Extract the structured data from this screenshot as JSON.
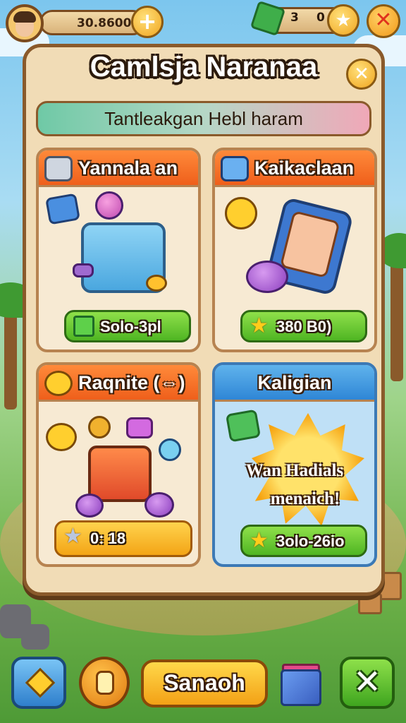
{
  "hud": {
    "coins": "30.8600",
    "gems_count": "3",
    "gems_extra": "0"
  },
  "panel": {
    "title": "Camlsja Naranaa",
    "subtitle": "Tantleakgan Hebl haram"
  },
  "cards": [
    {
      "title": "Yannala an",
      "price": "Solo-3pl",
      "price_icon": "cash-icon",
      "theme": "orange"
    },
    {
      "title": "Kaikaclaan",
      "price": "380 B0)",
      "price_icon": "star-icon",
      "theme": "orange"
    },
    {
      "title": "Raqnite (⇔)",
      "price": "0: 18",
      "price_icon": "star-icon",
      "theme": "orange"
    },
    {
      "title": "Kaligian",
      "burst_line1": "Wan Hadials",
      "burst_line2": "menaich!",
      "price": "3olo-26io",
      "price_icon": "star-icon",
      "theme": "blue"
    }
  ],
  "bottom_bar": {
    "center_button": "Sanaoh"
  },
  "colors": {
    "panel_bg": "#f1dcb6",
    "card_header_orange": "#ef5f1b",
    "card_header_blue": "#2f86d6",
    "price_green": "#4fb523",
    "price_gold": "#f3a516"
  }
}
